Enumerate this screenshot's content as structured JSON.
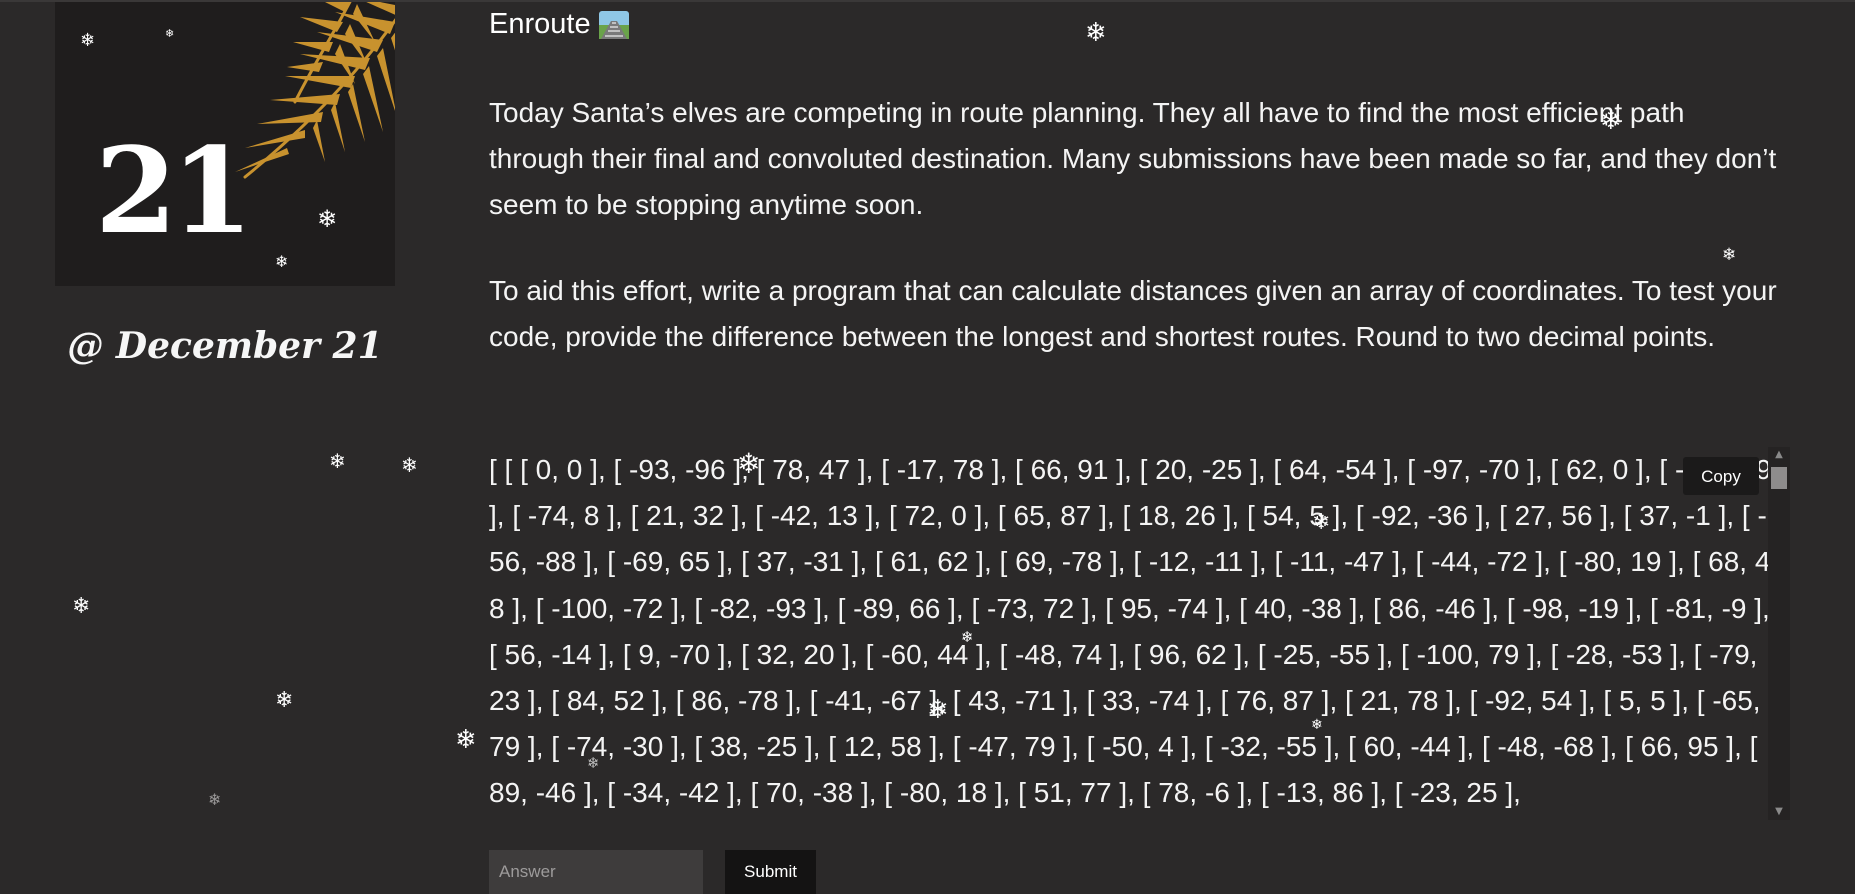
{
  "day_card": {
    "day_number": "21",
    "date_label": "@ December 21"
  },
  "puzzle": {
    "title": "Enroute",
    "title_icon": "railway-track-icon",
    "paragraphs": [
      "Today Santa’s elves are competing in route planning. They all have to find the most efficient path through their final and convoluted destination. Many submissions have been made so far, and they don’t seem to be stopping anytime soon.",
      "To aid this effort, write a program that can calculate distances given an array of coordinates. To test your code, provide the difference between the longest and shortest routes. Round to two decimal points."
    ],
    "input_data": "[ [ [ 0, 0 ], [ -93, -96 ], [ 78, 47 ], [ -17, 78 ], [ 66, 91 ], [ 20, -25 ], [ 64, -54 ], [ -97, -70 ], [ 62, 0 ], [ -86, -49 ], [ -74, 8 ], [ 21, 32 ], [ -42, 13 ], [ 72, 0 ], [ 65, 87 ], [ 18, 26 ], [ 54, 5 ], [ -92, -36 ], [ 27, 56 ], [ 37, -1 ], [ -56, -88 ], [ -69, 65 ], [ 37, -31 ], [ 61, 62 ], [ 69, -78 ], [ -12, -11 ], [ -11, -47 ], [ -44, -72 ], [ -80, 19 ], [ 68, 48 ], [ -100, -72 ], [ -82, -93 ], [ -89, 66 ], [ -73, 72 ], [ 95, -74 ], [ 40, -38 ], [ 86, -46 ], [ -98, -19 ], [ -81, -9 ], [ 56, -14 ], [ 9, -70 ], [ 32, 20 ], [ -60, 44 ], [ -48, 74 ], [ 96, 62 ], [ -25, -55 ], [ -100, 79 ], [ -28, -53 ], [ -79, 23 ], [ 84, 52 ], [ 86, -78 ], [ -41, -67 ], [ 43, -71 ], [ 33, -74 ], [ 76, 87 ], [ 21, 78 ], [ -92, 54 ], [ 5, 5 ], [ -65, 79 ], [ -74, -30 ], [ 38, -25 ], [ 12, 58 ], [ -47, 79 ], [ -50, 4 ], [ -32, -55 ], [ 60, -44 ], [ -48, -68 ], [ 66, 95 ], [ 89, -46 ], [ -34, -42 ], [ 70, -38 ], [ -80, 18 ], [ 51, 77 ], [ 78, -6 ], [ -13, 86 ], [ -23, 25 ],",
    "copy_label": "Copy",
    "answer_placeholder": "Answer",
    "submit_label": "Submit"
  },
  "decor": {
    "snowflake_icon": "snowflake-icon",
    "snowflake_glyph": "❄",
    "colors": {
      "background": "#2b2929",
      "card": "#1f1d1d",
      "branch": "#c8922e",
      "text": "#f4f4f4"
    }
  }
}
